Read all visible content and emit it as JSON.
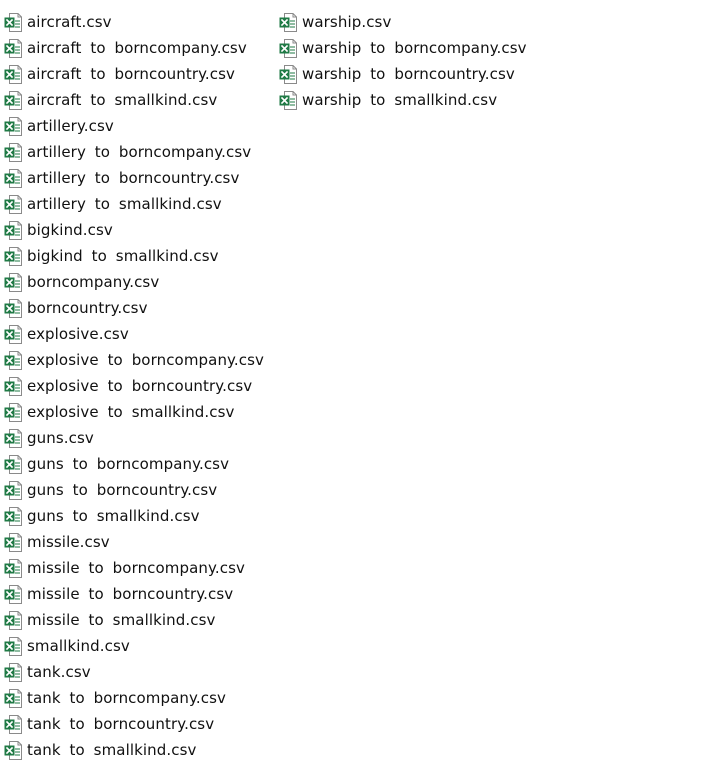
{
  "colors": {
    "excel_green": "#1f7a45",
    "background": "#ffffff",
    "text": "#111111"
  },
  "icon_name": "excel-csv-file-icon",
  "columns": [
    {
      "files": [
        "aircraft.csv",
        "aircraft to borncompany.csv",
        "aircraft to borncountry.csv",
        "aircraft to smallkind.csv",
        "artillery.csv",
        "artillery to borncompany.csv",
        "artillery to borncountry.csv",
        "artillery to smallkind.csv",
        "bigkind.csv",
        "bigkind to smallkind.csv",
        "borncompany.csv",
        "borncountry.csv",
        "explosive.csv",
        "explosive to borncompany.csv",
        "explosive to borncountry.csv",
        "explosive to smallkind.csv",
        "guns.csv",
        "guns to borncompany.csv",
        "guns to borncountry.csv",
        "guns to smallkind.csv",
        "missile.csv",
        "missile to borncompany.csv",
        "missile to borncountry.csv",
        "missile to smallkind.csv",
        "smallkind.csv",
        "tank.csv",
        "tank to borncompany.csv",
        "tank to borncountry.csv",
        "tank to smallkind.csv"
      ]
    },
    {
      "files": [
        "warship.csv",
        "warship to borncompany.csv",
        "warship to borncountry.csv",
        "warship to smallkind.csv"
      ]
    }
  ]
}
